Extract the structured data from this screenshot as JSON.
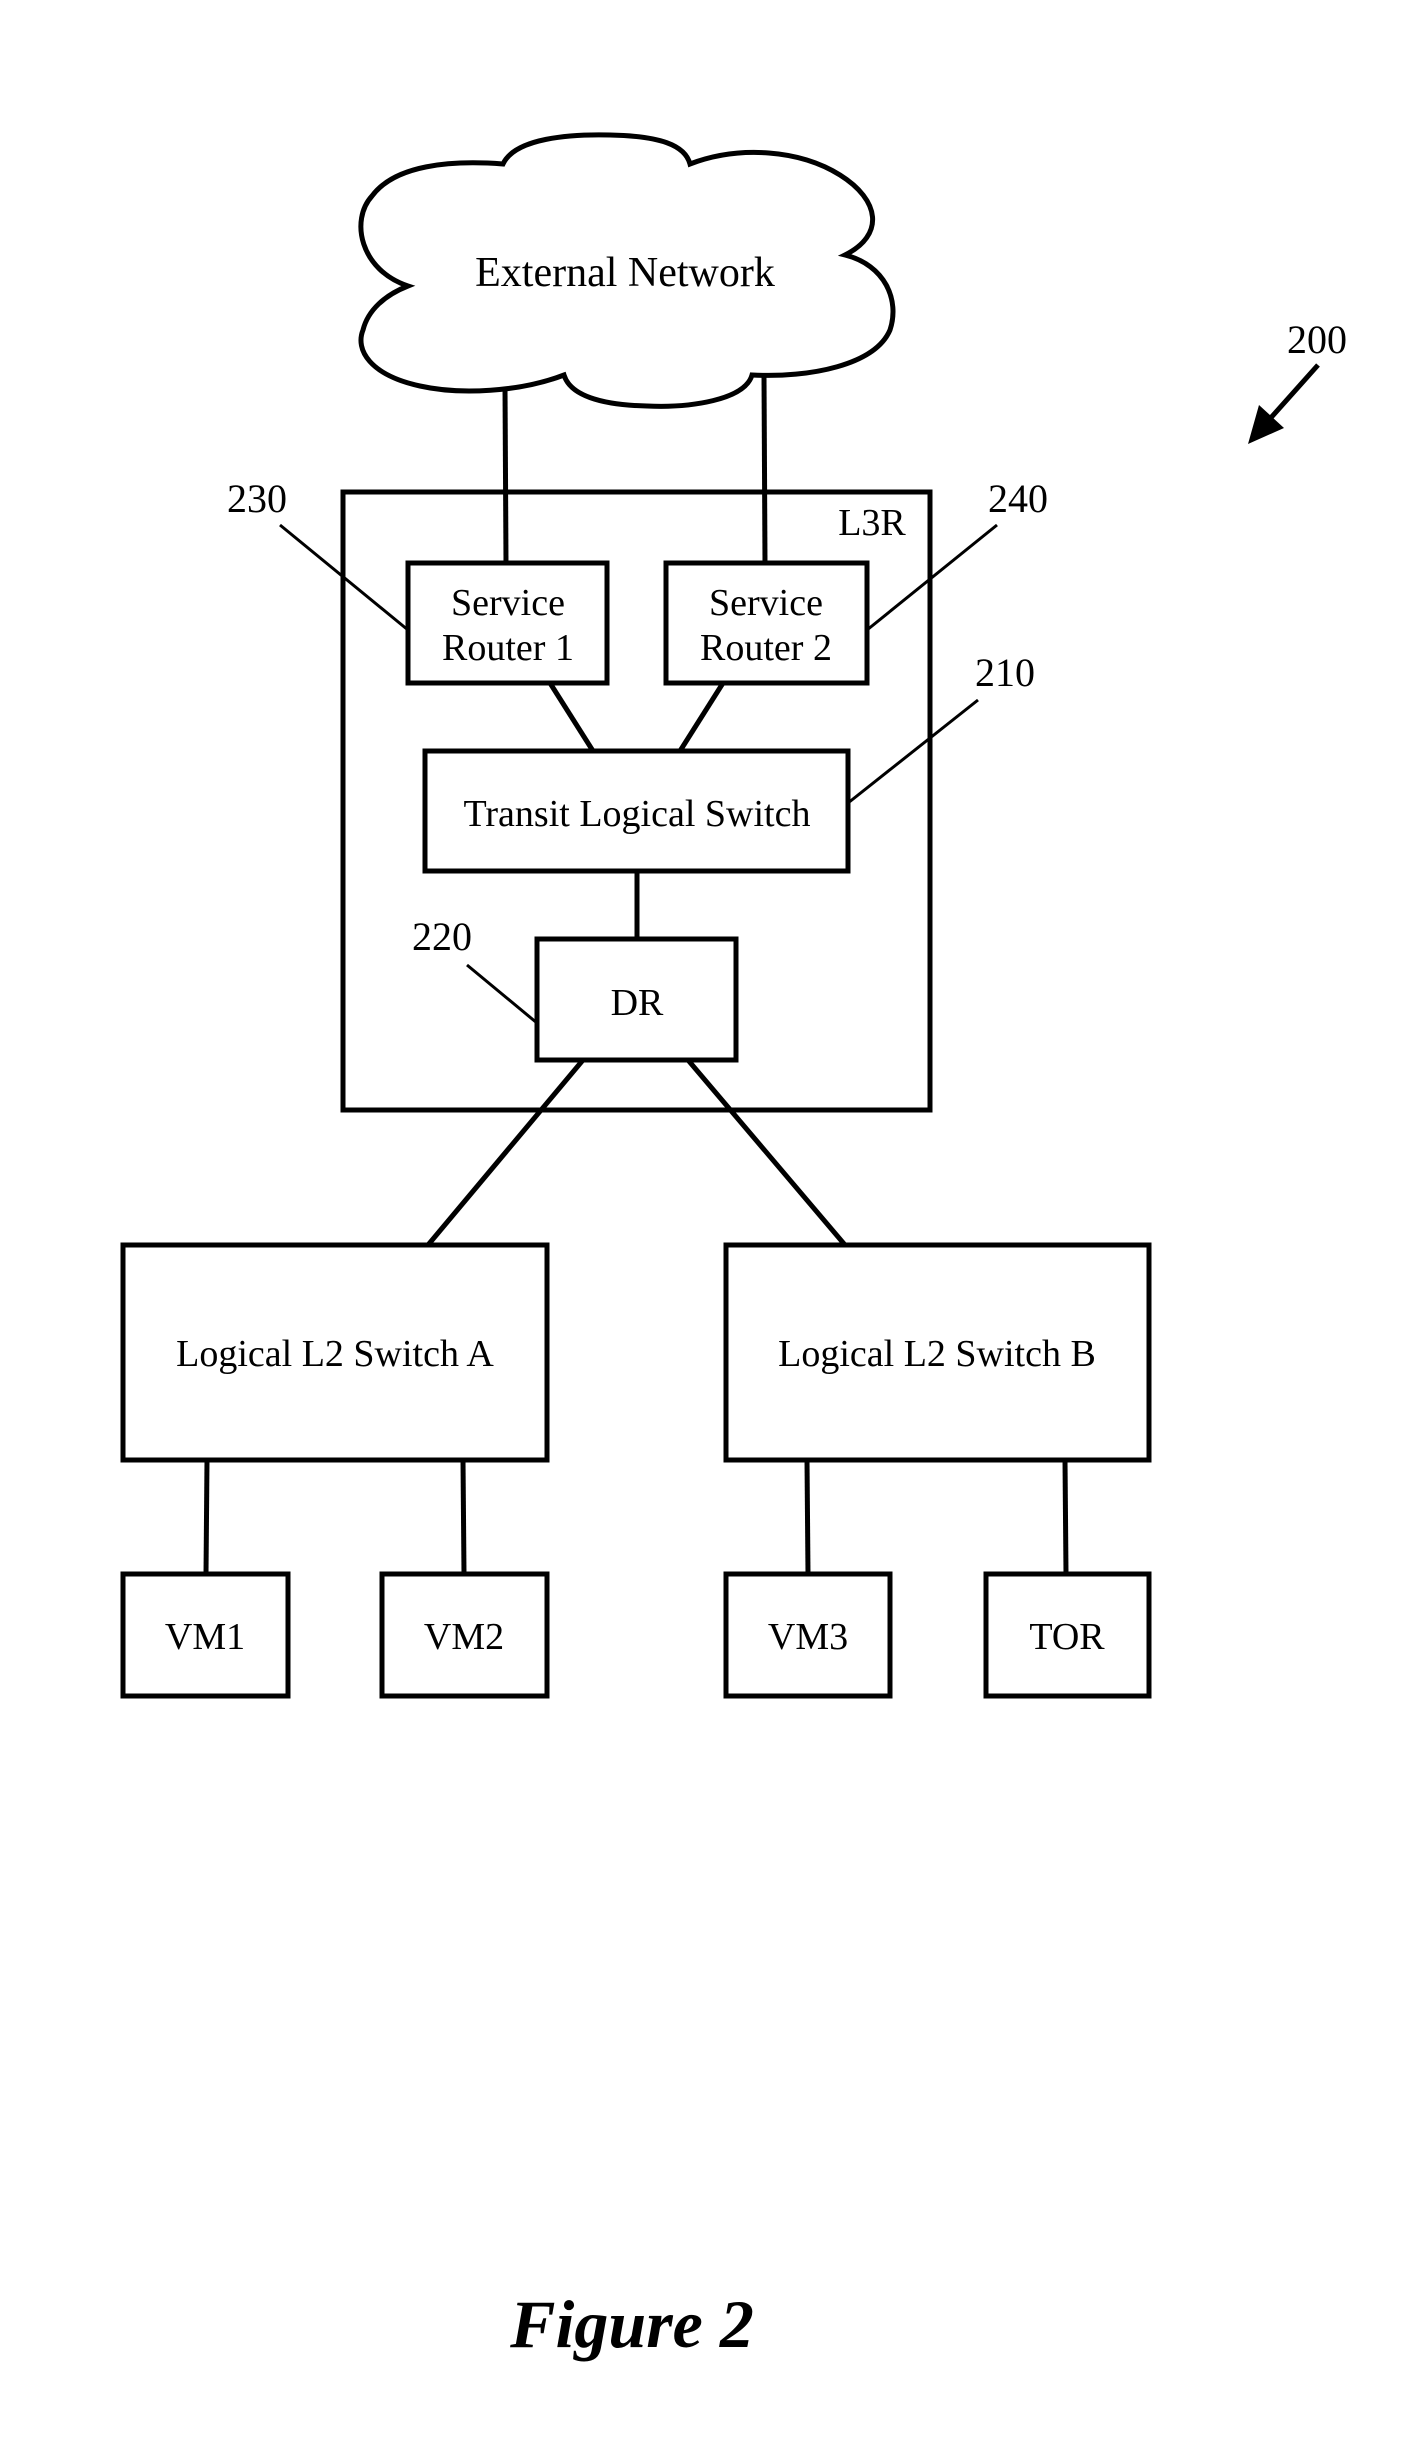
{
  "figure": {
    "caption": "Figure 2",
    "reference_number": "200"
  },
  "external_network": {
    "label": "External Network",
    "shape": "cloud-icon"
  },
  "l3_router": {
    "label": "L3R",
    "service_router_1": {
      "line1": "Service",
      "line2": "Router 1",
      "ref": "230"
    },
    "service_router_2": {
      "line1": "Service",
      "line2": "Router 2",
      "ref": "240"
    },
    "transit_logical_switch": {
      "label": "Transit Logical Switch",
      "ref": "210"
    },
    "distributed_router": {
      "label": "DR",
      "ref": "220"
    }
  },
  "switches": [
    {
      "label": "Logical L2 Switch A"
    },
    {
      "label": "Logical L2 Switch B"
    }
  ],
  "endpoints": [
    {
      "label": "VM1"
    },
    {
      "label": "VM2"
    },
    {
      "label": "VM3"
    },
    {
      "label": "TOR"
    }
  ]
}
